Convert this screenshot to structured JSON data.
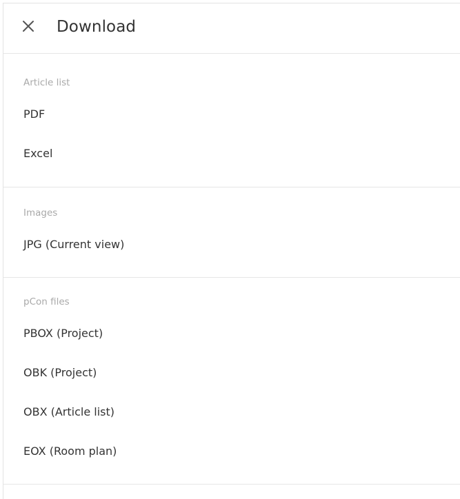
{
  "header": {
    "title": "Download",
    "close_icon": "close-icon"
  },
  "sections": [
    {
      "label": "Article list",
      "items": [
        "PDF",
        "Excel"
      ]
    },
    {
      "label": "Images",
      "items": [
        "JPG (Current view)"
      ]
    },
    {
      "label": "pCon files",
      "items": [
        "PBOX (Project)",
        "OBK (Project)",
        "OBX (Article list)",
        "EOX (Room plan)"
      ]
    }
  ],
  "colors": {
    "text": "#333333",
    "section_label": "#a9a9a9",
    "divider": "#e6e6e6"
  }
}
